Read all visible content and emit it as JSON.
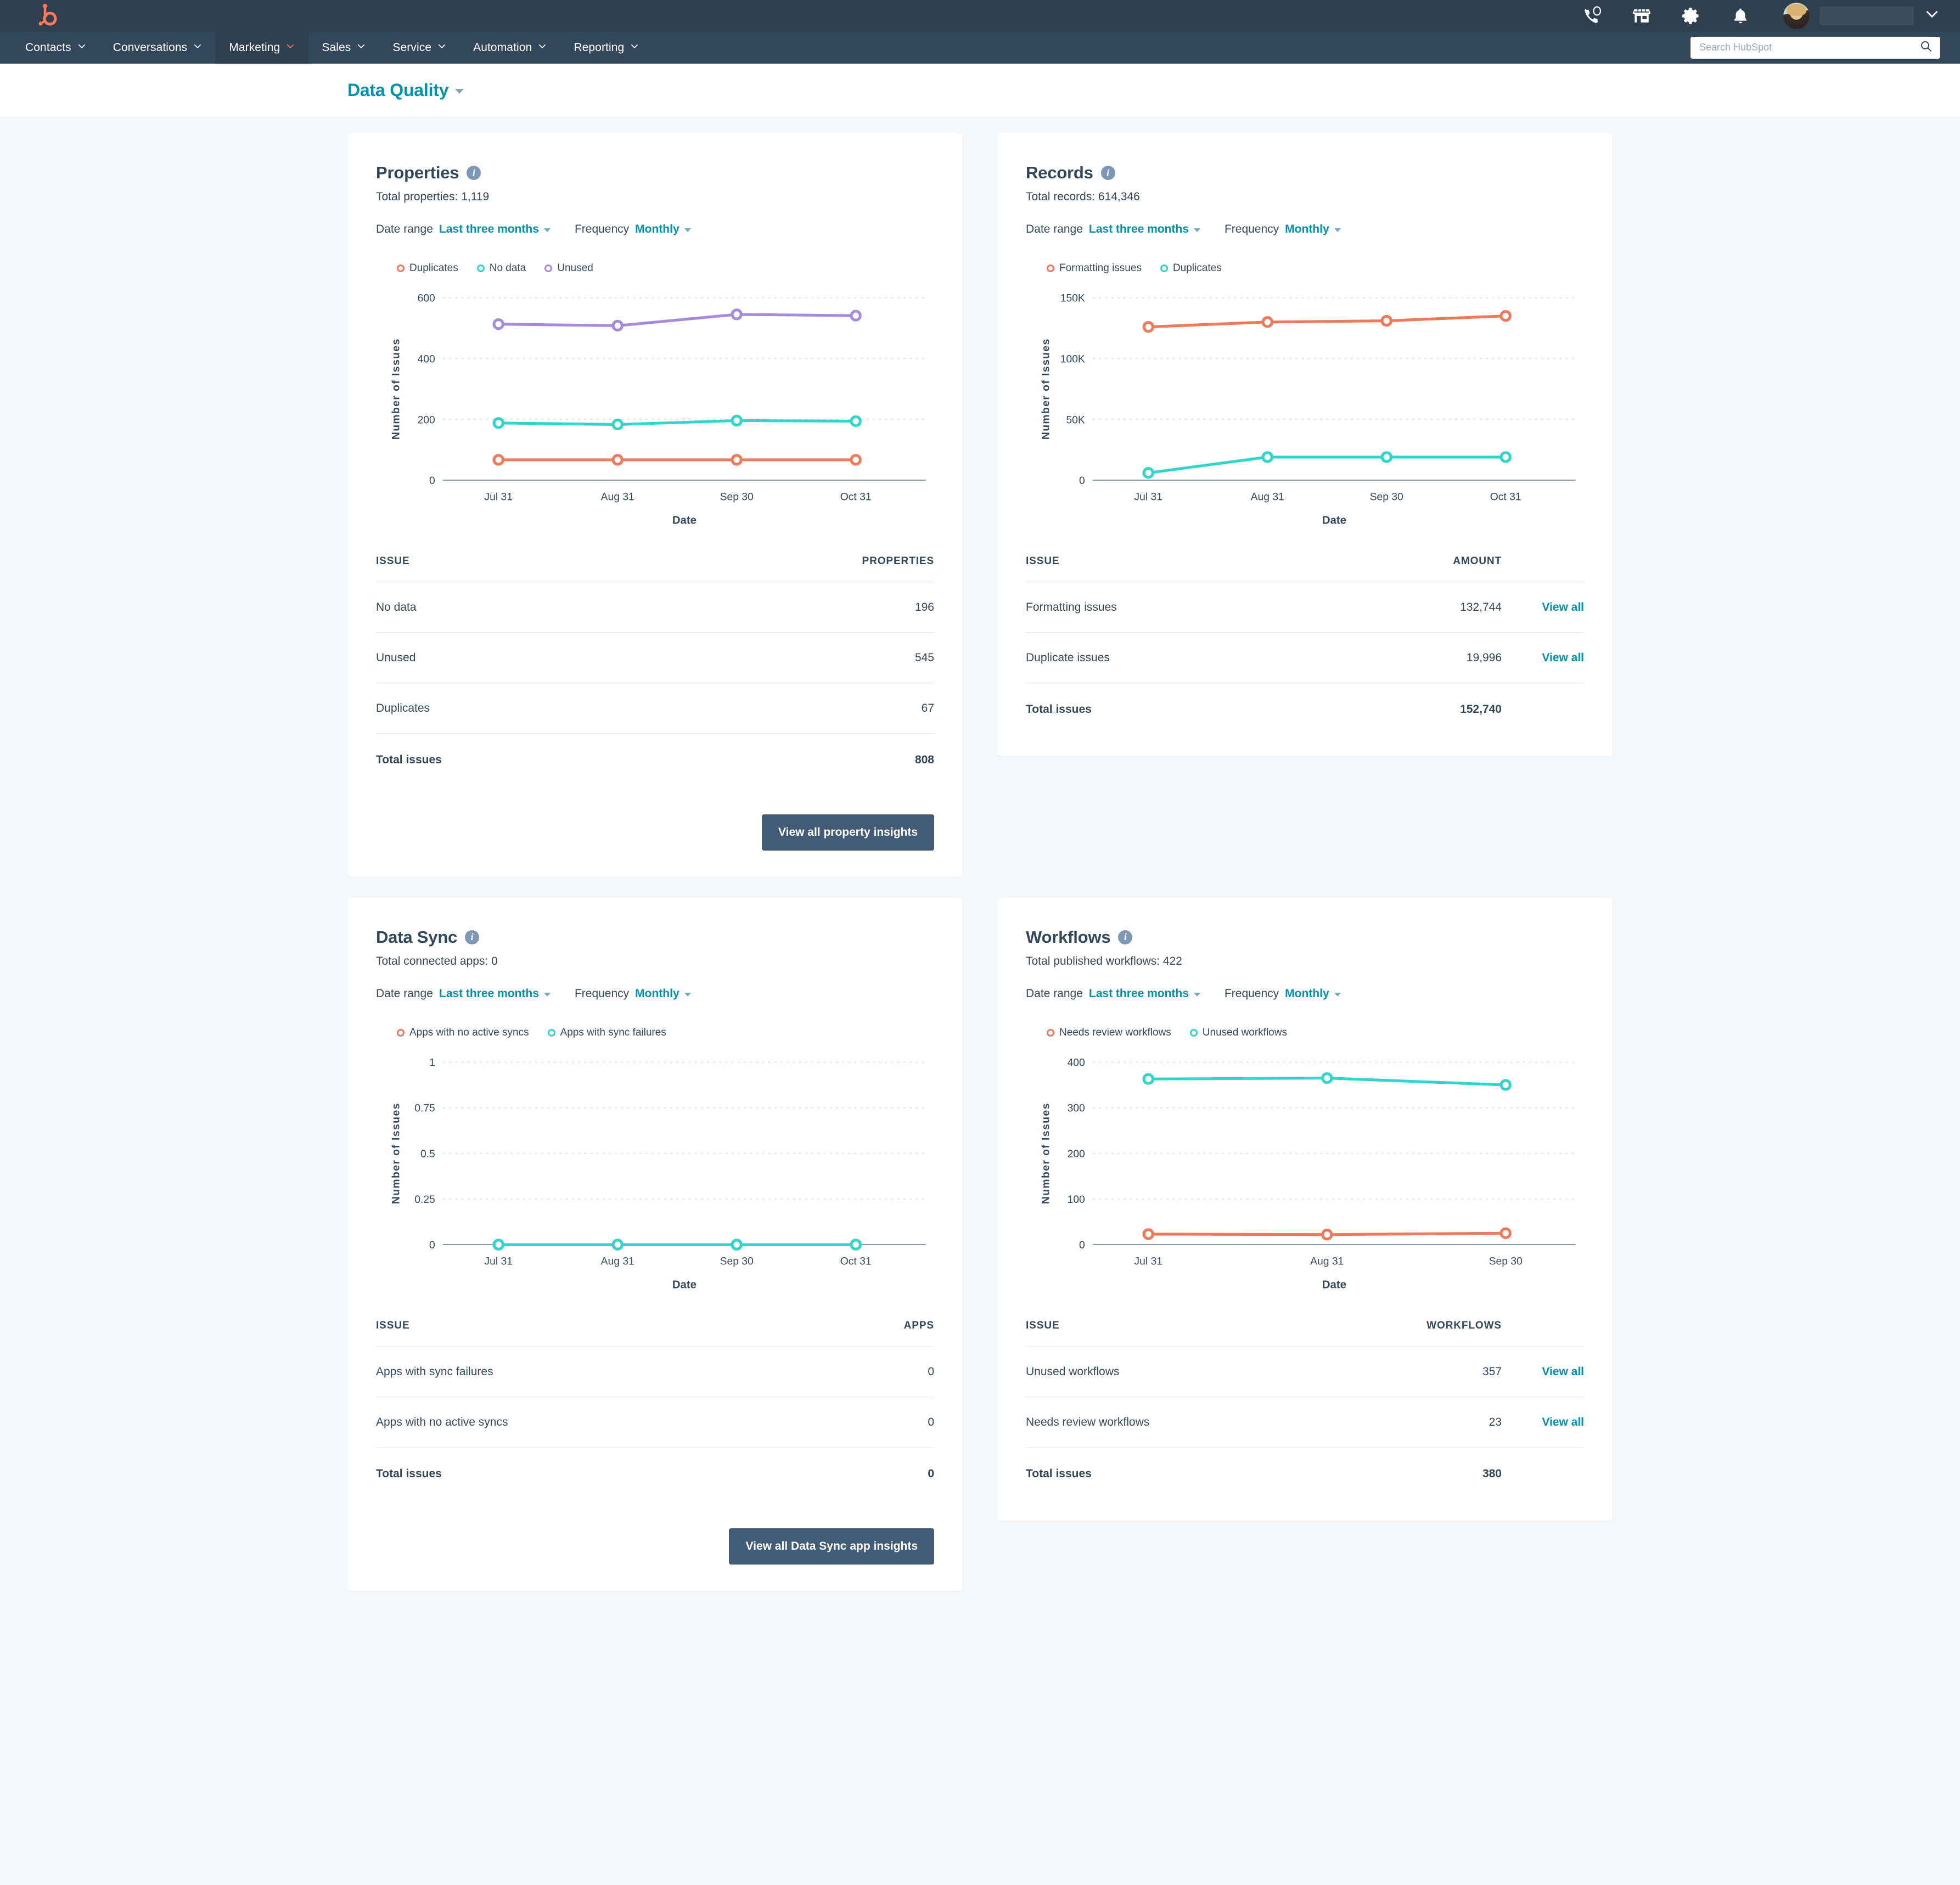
{
  "topbar": {
    "logo_name": "hubspot-logo",
    "icons": [
      {
        "name": "phone-icon",
        "label": "Calling"
      },
      {
        "name": "marketplace-icon",
        "label": "Marketplace"
      },
      {
        "name": "gear-icon",
        "label": "Settings"
      },
      {
        "name": "bell-icon",
        "label": "Notifications"
      }
    ],
    "account_name": ""
  },
  "nav": {
    "items": [
      {
        "label": "Contacts",
        "active": false
      },
      {
        "label": "Conversations",
        "active": false
      },
      {
        "label": "Marketing",
        "active": true
      },
      {
        "label": "Sales",
        "active": false
      },
      {
        "label": "Service",
        "active": false
      },
      {
        "label": "Automation",
        "active": false
      },
      {
        "label": "Reporting",
        "active": false
      }
    ],
    "search_placeholder": "Search HubSpot",
    "search_value": ""
  },
  "page": {
    "title": "Data Quality"
  },
  "colors": {
    "coral": "#F2785C",
    "teal": "#2FD6CC",
    "purple": "#A78BDB",
    "link": "#0091AE",
    "axis": "#7C98B6",
    "text": "#33475B",
    "button": "#425B76",
    "page_bg": "#F5F8FA",
    "navy": "#2E3F50"
  },
  "cards": {
    "properties": {
      "title": "Properties",
      "subtitle": "Total properties: 1,119",
      "date_range_label": "Date range",
      "date_range_value": "Last three months",
      "frequency_label": "Frequency",
      "frequency_value": "Monthly",
      "table": {
        "headers": [
          "ISSUE",
          "PROPERTIES"
        ],
        "rows": [
          {
            "issue": "No data",
            "amount": "196"
          },
          {
            "issue": "Unused",
            "amount": "545"
          },
          {
            "issue": "Duplicates",
            "amount": "67"
          }
        ],
        "total_label": "Total issues",
        "total_value": "808"
      },
      "button_label": "View all property insights"
    },
    "records": {
      "title": "Records",
      "subtitle": "Total records: 614,346",
      "date_range_label": "Date range",
      "date_range_value": "Last three months",
      "frequency_label": "Frequency",
      "frequency_value": "Monthly",
      "table": {
        "headers": [
          "ISSUE",
          "AMOUNT"
        ],
        "rows": [
          {
            "issue": "Formatting issues",
            "amount": "132,744",
            "action": "View all"
          },
          {
            "issue": "Duplicate issues",
            "amount": "19,996",
            "action": "View all"
          }
        ],
        "total_label": "Total issues",
        "total_value": "152,740"
      }
    },
    "datasync": {
      "title": "Data Sync",
      "subtitle": "Total connected apps: 0",
      "date_range_label": "Date range",
      "date_range_value": "Last three months",
      "frequency_label": "Frequency",
      "frequency_value": "Monthly",
      "table": {
        "headers": [
          "ISSUE",
          "APPS"
        ],
        "rows": [
          {
            "issue": "Apps with sync failures",
            "amount": "0"
          },
          {
            "issue": "Apps with no active syncs",
            "amount": "0"
          }
        ],
        "total_label": "Total issues",
        "total_value": "0"
      },
      "button_label": "View all Data Sync app insights"
    },
    "workflows": {
      "title": "Workflows",
      "subtitle": "Total published workflows: 422",
      "date_range_label": "Date range",
      "date_range_value": "Last three months",
      "frequency_label": "Frequency",
      "frequency_value": "Monthly",
      "table": {
        "headers": [
          "ISSUE",
          "WORKFLOWS"
        ],
        "rows": [
          {
            "issue": "Unused workflows",
            "amount": "357",
            "action": "View all"
          },
          {
            "issue": "Needs review workflows",
            "amount": "23",
            "action": "View all"
          }
        ],
        "total_label": "Total issues",
        "total_value": "380"
      }
    }
  },
  "chart_data": [
    {
      "id": "properties",
      "type": "line",
      "title": "",
      "xlabel": "Date",
      "ylabel": "Number of Issues",
      "categories": [
        "Jul 31",
        "Aug 31",
        "Sep 30",
        "Oct 31"
      ],
      "yticks": [
        0,
        200,
        400,
        600
      ],
      "ytick_labels": [
        "0",
        "200",
        "400",
        "600"
      ],
      "ylim": [
        0,
        600
      ],
      "grid": true,
      "legend_position": "top-left",
      "series": [
        {
          "name": "Duplicates",
          "color": "#F2785C",
          "values": [
            67,
            67,
            67,
            67
          ]
        },
        {
          "name": "No data",
          "color": "#2FD6CC",
          "values": [
            188,
            183,
            196,
            194
          ]
        },
        {
          "name": "Unused",
          "color": "#A78BDB",
          "values": [
            513,
            508,
            545,
            541
          ]
        }
      ]
    },
    {
      "id": "records",
      "type": "line",
      "title": "",
      "xlabel": "Date",
      "ylabel": "Number of Issues",
      "categories": [
        "Jul 31",
        "Aug 31",
        "Sep 30",
        "Oct 31"
      ],
      "yticks": [
        0,
        50000,
        100000,
        150000
      ],
      "ytick_labels": [
        "0",
        "50K",
        "100K",
        "150K"
      ],
      "ylim": [
        0,
        150000
      ],
      "grid": true,
      "legend_position": "top-left",
      "series": [
        {
          "name": "Formatting issues",
          "color": "#F2785C",
          "values": [
            126000,
            130000,
            131000,
            135000
          ]
        },
        {
          "name": "Duplicates",
          "color": "#2FD6CC",
          "values": [
            6000,
            19000,
            19000,
            19000
          ]
        }
      ]
    },
    {
      "id": "datasync",
      "type": "line",
      "title": "",
      "xlabel": "Date",
      "ylabel": "Number of Issues",
      "categories": [
        "Jul 31",
        "Aug 31",
        "Sep 30",
        "Oct 31"
      ],
      "yticks": [
        0,
        0.25,
        0.5,
        0.75,
        1
      ],
      "ytick_labels": [
        "0",
        "0.25",
        "0.5",
        "0.75",
        "1"
      ],
      "ylim": [
        0,
        1
      ],
      "grid": true,
      "legend_position": "top-left",
      "series": [
        {
          "name": "Apps with no active syncs",
          "color": "#F2785C",
          "values": [
            0,
            0,
            0,
            0
          ]
        },
        {
          "name": "Apps with sync failures",
          "color": "#2FD6CC",
          "values": [
            0,
            0,
            0,
            0
          ]
        }
      ]
    },
    {
      "id": "workflows",
      "type": "line",
      "title": "",
      "xlabel": "Date",
      "ylabel": "Number of Issues",
      "categories": [
        "Jul 31",
        "Aug 31",
        "Sep 30"
      ],
      "yticks": [
        0,
        100,
        200,
        300,
        400
      ],
      "ytick_labels": [
        "0",
        "100",
        "200",
        "300",
        "400"
      ],
      "ylim": [
        0,
        400
      ],
      "grid": true,
      "legend_position": "top-left",
      "series": [
        {
          "name": "Needs review workflows",
          "color": "#F2785C",
          "values": [
            23,
            22,
            25
          ]
        },
        {
          "name": "Unused workflows",
          "color": "#2FD6CC",
          "values": [
            363,
            365,
            350
          ]
        }
      ]
    }
  ]
}
